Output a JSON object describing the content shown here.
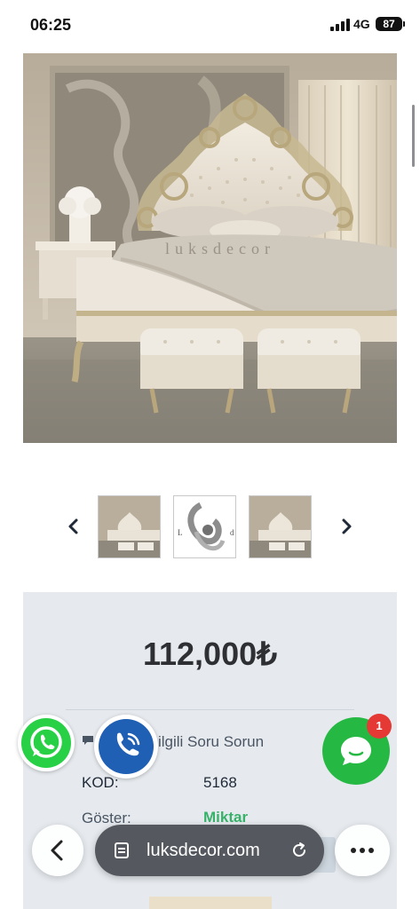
{
  "status_bar": {
    "time": "06:25",
    "network": "4G",
    "battery": "87"
  },
  "product": {
    "watermark": "luksdecor",
    "price": "112,000₺",
    "ask_question": "ilgili Soru Sorun",
    "code_label": "KOD:",
    "code_value": "5168",
    "show_label": "Göster:",
    "quantity_label": "Miktar"
  },
  "thumbnails": [
    {
      "name": "bed-thumbnail-1"
    },
    {
      "name": "headboard-detail-thumbnail",
      "caption_left": "L",
      "caption_right": "d"
    },
    {
      "name": "bed-thumbnail-3"
    }
  ],
  "contact": {
    "chat_badge": "1"
  },
  "browser": {
    "url": "luksdecor.com"
  },
  "colors": {
    "whatsapp": "#27d045",
    "call": "#1f5fb4",
    "chat": "#25b944",
    "badge": "#e53935",
    "price_text": "#2d2f33",
    "quantity": "#38b26a"
  }
}
